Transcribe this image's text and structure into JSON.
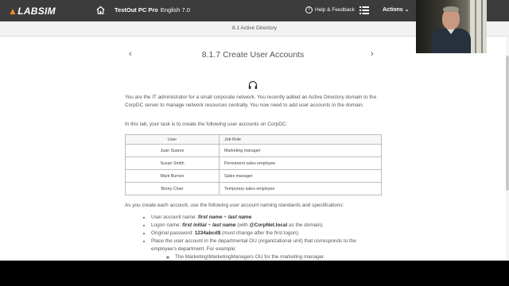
{
  "nav": {
    "logo_prefix": "",
    "logo_text": "LABSIM",
    "course_title": "TestOut PC Pro",
    "course_version": "English 7.0",
    "help_label": "Help & Feedback",
    "actions_label": "Actions"
  },
  "section_title": "8.1 Active Directory",
  "lesson": {
    "title": "8.1.7 Create User Accounts",
    "intro": "You are the IT administrator for a small corporate network. You recently added an Active Directory domain to the CorpDC server to manage network resources centrally. You now need to add user accounts in the domain.",
    "task": "In this lab, your task is to create the following user accounts on CorpDC:",
    "table": {
      "headers": [
        "User",
        "Job Role"
      ],
      "rows": [
        [
          "Juan Suarez",
          "Marketing manager"
        ],
        [
          "Susan Smith",
          "Permanent sales employee"
        ],
        [
          "Mark Burnes",
          "Sales manager"
        ],
        [
          "Borey Chan",
          "Temporary sales employee"
        ]
      ]
    },
    "naming_intro": "As you create each account, use the following user account naming standards and specifications:",
    "requirements": {
      "r1_a": "User account name: ",
      "r1_b": "first name",
      "r1_c": " + ",
      "r1_d": "last name",
      "r2_a": "Logon name: ",
      "r2_b": "first initial",
      "r2_c": " + ",
      "r2_d": "last name",
      "r2_e": " (with ",
      "r2_f": "@CorpNet.local",
      "r2_g": " as the domain).",
      "r3_a": "Original password: ",
      "r3_b": "1234abcd$",
      "r3_c": " (must change after the first logon).",
      "r4": "Place the user account in the departmental OU (organizational unit) that corresponds to the employee's department. For example:",
      "r4_sub": "The Marketing\\MarketingManagers OU for the marketing manager."
    }
  },
  "icons": {
    "home": "home-icon",
    "help": "help-icon",
    "menu": "menu-icon",
    "actions": "chevron-down-icon",
    "prev": "chevron-left-icon",
    "next": "chevron-right-icon",
    "audio": "headphones-icon"
  },
  "colors": {
    "topbar": "#3c3c3c",
    "logo_accent": "#f28b24",
    "text": "#555555"
  }
}
